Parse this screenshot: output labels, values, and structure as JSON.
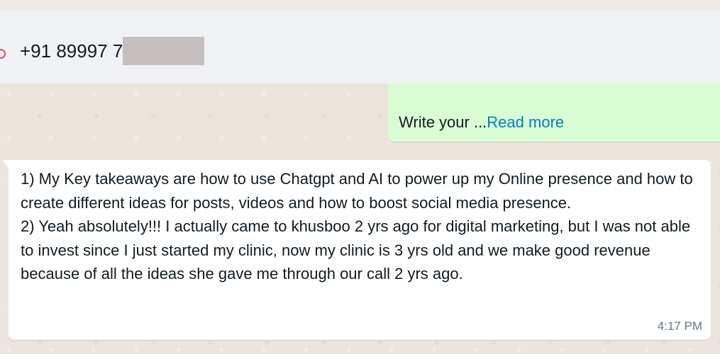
{
  "header": {
    "contact_number": "+91 89997 7"
  },
  "outgoing_message": {
    "truncated_text": "Write your ...",
    "read_more_label": "Read more"
  },
  "incoming_message": {
    "paragraphs": [
      "1) My Key takeaways are how to use Chatgpt and AI to power up my Online presence and how to create different ideas for posts, videos and how to boost social media presence.",
      "2) Yeah absolutely!!! I actually came to khusboo 2 yrs ago for digital marketing, but I was not able to invest since I just started my clinic, now my clinic is 3 yrs old and we make good revenue because of all the ideas she gave me through our call 2 yrs ago."
    ],
    "timestamp": "4:17 PM"
  },
  "colors": {
    "header_bg": "#f0f2f5",
    "outgoing_bg": "#d9fdd3",
    "incoming_bg": "#ffffff",
    "link": "#027eb5",
    "timestamp": "#667781"
  }
}
